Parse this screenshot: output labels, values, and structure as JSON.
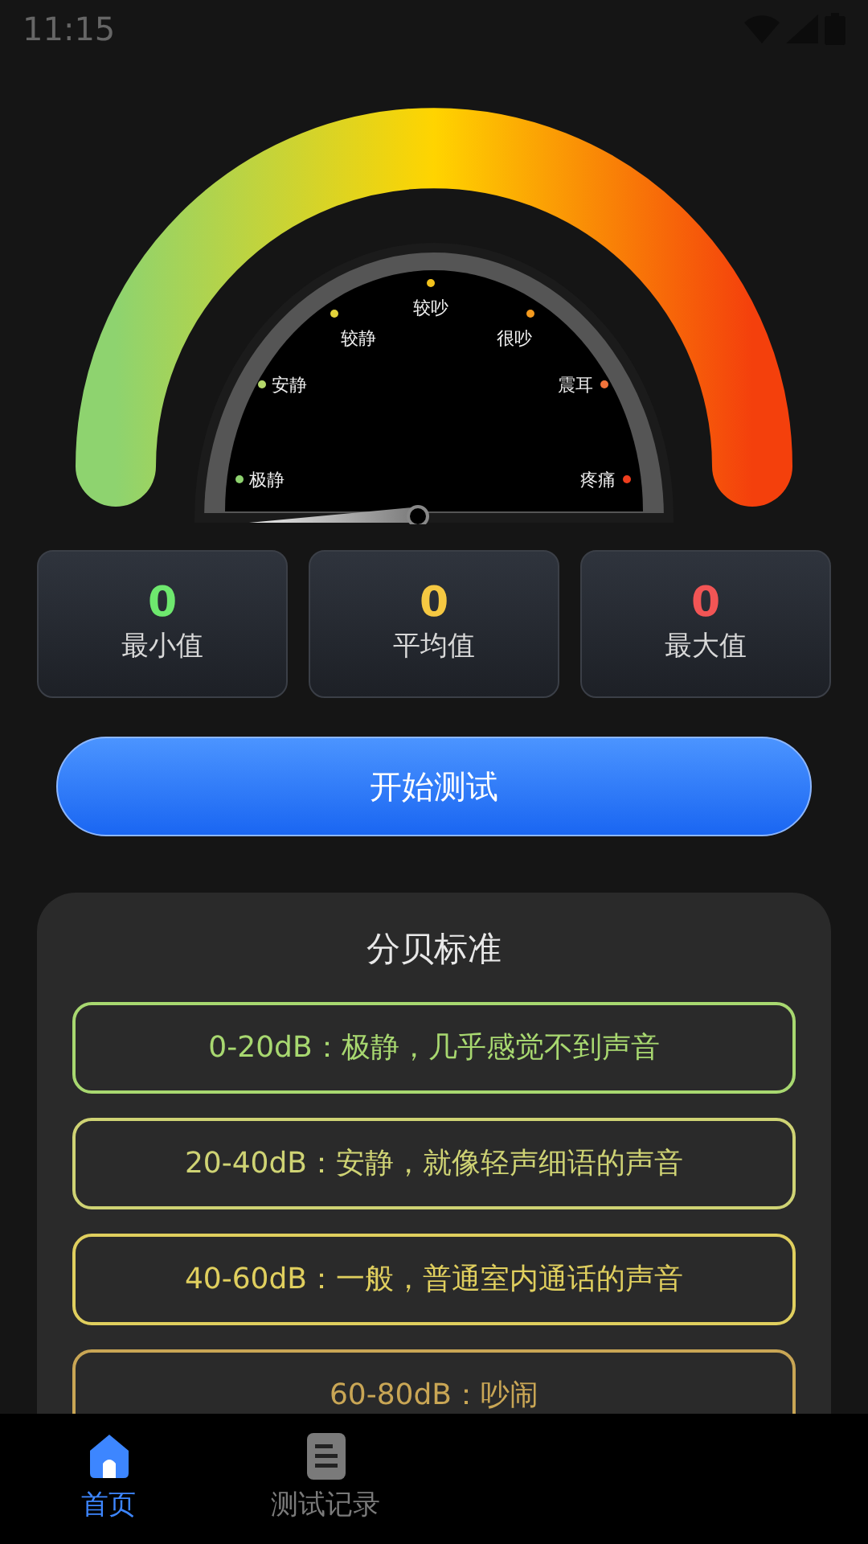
{
  "status_bar": {
    "time": "11:15"
  },
  "gauge": {
    "labels": [
      {
        "text": "极静",
        "color": "#8ed36f"
      },
      {
        "text": "安静",
        "color": "#b5d86a"
      },
      {
        "text": "较静",
        "color": "#e3d33a"
      },
      {
        "text": "较吵",
        "color": "#f2c21c"
      },
      {
        "text": "很吵",
        "color": "#f49a1e"
      },
      {
        "text": "震耳",
        "color": "#f2733a"
      },
      {
        "text": "疼痛",
        "color": "#ee3e1e"
      }
    ]
  },
  "stats": [
    {
      "value": "0",
      "label": "最小值",
      "color": "#6ee86e"
    },
    {
      "value": "0",
      "label": "平均值",
      "color": "#f5c842"
    },
    {
      "value": "0",
      "label": "最大值",
      "color": "#f25555"
    }
  ],
  "start_button": "开始测试",
  "standards": {
    "title": "分贝标准",
    "rows": [
      {
        "text": "0-20dB：极静，几乎感觉不到声音",
        "color": "#a8d870"
      },
      {
        "text": "20-40dB：安静，就像轻声细语的声音",
        "color": "#cfd374"
      },
      {
        "text": "40-60dB：一般，普通室内通话的声音",
        "color": "#e0cf5e"
      },
      {
        "text": "60-80dB：吵闹",
        "color": "#c9a655"
      }
    ]
  },
  "bottom_nav": [
    {
      "label": "首页",
      "kind": "home",
      "selected": true
    },
    {
      "label": "测试记录",
      "kind": "list",
      "selected": false
    }
  ]
}
